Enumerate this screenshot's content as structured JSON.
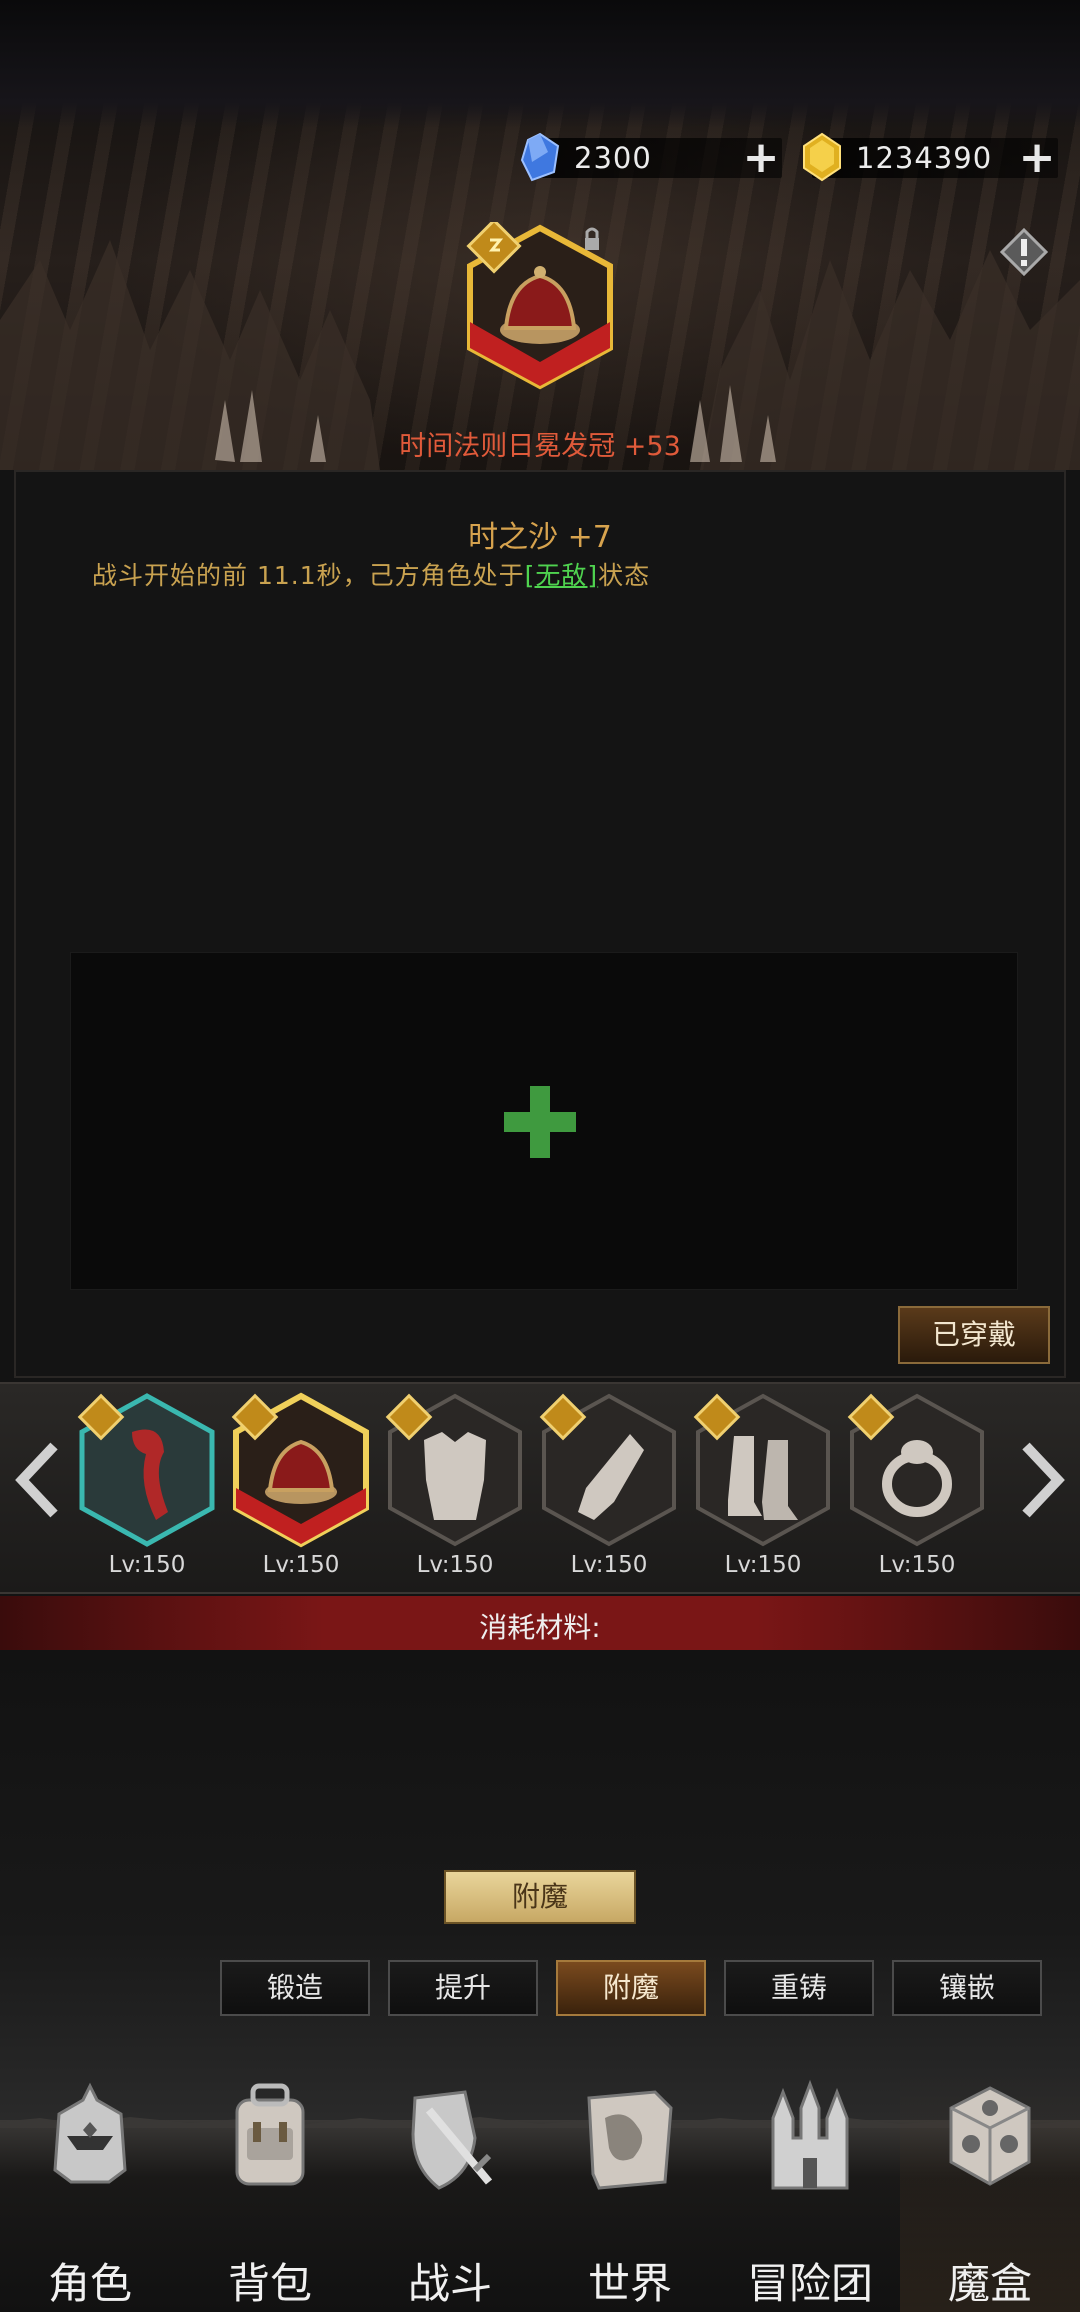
{
  "currency": {
    "gem": {
      "value": "2300",
      "icon": "blue-gem-icon"
    },
    "gold": {
      "value": "1234390",
      "icon": "gold-gem-icon"
    }
  },
  "equipment": {
    "name": "时间法则日冕发冠 +53"
  },
  "detail": {
    "title": "时之沙 +7",
    "desc_prefix": "战斗开始的前 11.1秒，己方角色处于",
    "desc_highlight": "[无敌]",
    "desc_suffix": "状态",
    "equipped_label": "已穿戴"
  },
  "equip_list": [
    {
      "icon": "scarf-icon",
      "level": "Lv:150",
      "frame": "teal"
    },
    {
      "icon": "crown-icon",
      "level": "Lv:150",
      "frame": "red",
      "selected": true
    },
    {
      "icon": "armor-icon",
      "level": "Lv:150",
      "frame": "gray"
    },
    {
      "icon": "gauntlet-icon",
      "level": "Lv:150",
      "frame": "gray"
    },
    {
      "icon": "boots-icon",
      "level": "Lv:150",
      "frame": "gray"
    },
    {
      "icon": "ring-icon",
      "level": "Lv:150",
      "frame": "gray"
    }
  ],
  "consume_label": "消耗材料:",
  "enchant_button": "附魔",
  "tabs": [
    {
      "label": "锻造",
      "active": false
    },
    {
      "label": "提升",
      "active": false
    },
    {
      "label": "附魔",
      "active": true
    },
    {
      "label": "重铸",
      "active": false
    },
    {
      "label": "镶嵌",
      "active": false
    }
  ],
  "nav": [
    {
      "label": "角色",
      "icon": "helmet-icon"
    },
    {
      "label": "背包",
      "icon": "backpack-icon"
    },
    {
      "label": "战斗",
      "icon": "sword-shield-icon"
    },
    {
      "label": "世界",
      "icon": "map-icon"
    },
    {
      "label": "冒险团",
      "icon": "castle-icon"
    },
    {
      "label": "魔盒",
      "icon": "magic-cube-icon",
      "active": true
    }
  ]
}
